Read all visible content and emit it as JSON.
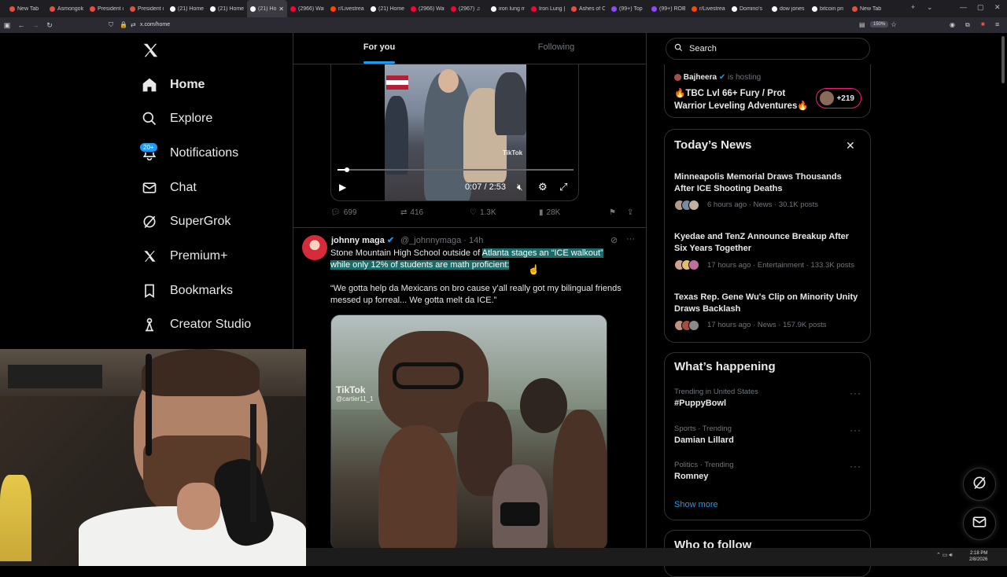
{
  "browser": {
    "tabs": [
      {
        "label": "New Tab",
        "color": "#e84f3c"
      },
      {
        "label": "Asmongold",
        "color": "#e84f3c"
      },
      {
        "label": "President o",
        "color": "#e84f3c"
      },
      {
        "label": "President o",
        "color": "#e84f3c"
      },
      {
        "label": "(21) Home",
        "color": "#ffffff"
      },
      {
        "label": "(21) Home",
        "color": "#ffffff"
      },
      {
        "label": "(21) Ho",
        "color": "#ffffff"
      },
      {
        "label": "(2966) Wat",
        "color": "#ff0033"
      },
      {
        "label": "r/Livestrea",
        "color": "#ff4500"
      },
      {
        "label": "(21) Home",
        "color": "#ffffff"
      },
      {
        "label": "(2966) Wat",
        "color": "#ff0033"
      },
      {
        "label": "(2967) ♫",
        "color": "#ff0033"
      },
      {
        "label": "iron lung m",
        "color": "#ffffff"
      },
      {
        "label": "Iron Lung |",
        "color": "#ff0033"
      },
      {
        "label": "Ashes of C",
        "color": "#e84f3c"
      },
      {
        "label": "(99+) Top",
        "color": "#9146ff"
      },
      {
        "label": "(99+) ROBl",
        "color": "#9146ff"
      },
      {
        "label": "r/Livestrea",
        "color": "#ff4500"
      },
      {
        "label": "Domino's",
        "color": "#ffffff"
      },
      {
        "label": "dow jones",
        "color": "#ffffff"
      },
      {
        "label": "bitcoin pri",
        "color": "#ffffff"
      },
      {
        "label": "New Tab",
        "color": "#e84f3c"
      }
    ],
    "active_tab_index": 6,
    "url": "x.com/home",
    "zoom": "150%"
  },
  "sidebar": {
    "items": [
      {
        "label": "Home",
        "icon": "home-icon"
      },
      {
        "label": "Explore",
        "icon": "search-icon"
      },
      {
        "label": "Notifications",
        "icon": "bell-icon"
      },
      {
        "label": "Chat",
        "icon": "mail-icon"
      },
      {
        "label": "SuperGrok",
        "icon": "grok-icon"
      },
      {
        "label": "Premium+",
        "icon": "x-logo-icon"
      },
      {
        "label": "Bookmarks",
        "icon": "bookmark-icon"
      },
      {
        "label": "Creator Studio",
        "icon": "creator-icon"
      }
    ],
    "notifications_badge": "20+"
  },
  "feed": {
    "tabs": {
      "for_you": "For you",
      "following": "Following"
    },
    "video1": {
      "time": "0:07 / 2:53",
      "progress": 0.04,
      "tiktok": "TikTok",
      "stats": {
        "replies": "699",
        "reposts": "416",
        "likes": "1.3K",
        "views": "28K"
      }
    },
    "tweet2": {
      "name": "johnny maga",
      "handle": "@_johnnymaga · 14h",
      "line1_plain": "Stone Mountain High School outside of ",
      "line1_highlight": "Atlanta stages an “ICE walkout”",
      "line2_highlight": "while only 12% of students are math proficient:",
      "quote1": "“We gotta help da Mexicans on bro cause y’all really got my bilingual friends",
      "quote2": "messed up forreal... We gotta melt da ICE.”",
      "tiktok": "TikTok",
      "tiktok_user": "@cartier11_1"
    }
  },
  "right": {
    "search_placeholder": "Search",
    "live": {
      "host": "Bajheera",
      "host_suffix": "is hosting",
      "title1": "🔥TBC Lvl 66+ Fury / Prot",
      "title2": "Warrior Leveling Adventures🔥",
      "count": "+219"
    },
    "news": {
      "title": "Today’s News",
      "items": [
        {
          "head1": "Minneapolis Memorial Draws Thousands",
          "head2": "After ICE Shooting Deaths",
          "meta": "6 hours ago · News · 30.1K posts"
        },
        {
          "head1": "Kyedae and TenZ Announce Breakup After",
          "head2": "Six Years Together",
          "meta": "17 hours ago · Entertainment · 133.3K posts"
        },
        {
          "head1": "Texas Rep. Gene Wu's Clip on Minority Unity",
          "head2": "Draws Backlash",
          "meta": "17 hours ago · News · 157.9K posts"
        }
      ]
    },
    "whats": {
      "title": "What’s happening",
      "trends": [
        {
          "meta": "Trending in United States",
          "name": "#PuppyBowl"
        },
        {
          "meta": "Sports · Trending",
          "name": "Damian Lillard"
        },
        {
          "meta": "Politics · Trending",
          "name": "Romney"
        }
      ],
      "show_more": "Show more"
    },
    "who_to_follow": "Who to follow"
  },
  "taskbar": {
    "time": "2:18 PM",
    "date": "2/8/2026"
  },
  "colors": {
    "accent": "#1d9bf0",
    "highlight": "#1b6b68",
    "live": "#f91880"
  }
}
